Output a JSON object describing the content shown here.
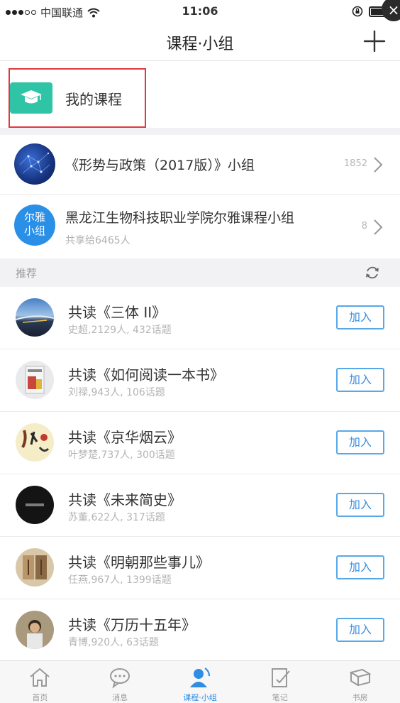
{
  "status_bar": {
    "carrier": "中国联通",
    "time": "11:06"
  },
  "nav": {
    "title": "课程·小组",
    "add_icon": "plus-icon"
  },
  "my_course": {
    "label": "我的课程",
    "icon": "graduation-cap-icon",
    "icon_color": "#2fc4a6",
    "highlight_color": "#e0383e"
  },
  "groups": [
    {
      "title": "《形势与政策（2017版）》小组",
      "count": "1852",
      "subtitle": ""
    },
    {
      "title": "黑龙江生物科技职业学院尔雅课程小组",
      "count": "8",
      "subtitle": "共享给6465人",
      "avatar_text_1": "尔雅",
      "avatar_text_2": "小组"
    }
  ],
  "recommend": {
    "label": "推荐",
    "join_label": "加入",
    "items": [
      {
        "title": "共读《三体 II》",
        "subtitle": "史超,2129人, 432话题"
      },
      {
        "title": "共读《如何阅读一本书》",
        "subtitle": "刘禄,943人, 106话题"
      },
      {
        "title": "共读《京华烟云》",
        "subtitle": "叶梦楚,737人, 300话题"
      },
      {
        "title": "共读《未来简史》",
        "subtitle": "苏董,622人, 317话题"
      },
      {
        "title": "共读《明朝那些事儿》",
        "subtitle": "任燕,967人, 1399话题"
      },
      {
        "title": "共读《万历十五年》",
        "subtitle": "青博,920人, 63话题"
      }
    ]
  },
  "tabs": [
    {
      "label": "首页",
      "icon": "home-icon"
    },
    {
      "label": "消息",
      "icon": "chat-icon"
    },
    {
      "label": "课程·小组",
      "icon": "person-icon",
      "active": true
    },
    {
      "label": "笔记",
      "icon": "note-edit-icon"
    },
    {
      "label": "书房",
      "icon": "books-icon"
    }
  ],
  "colors": {
    "accent": "#2f8de4",
    "join_border": "#58a8e8",
    "separator": "#f2f2f4"
  }
}
